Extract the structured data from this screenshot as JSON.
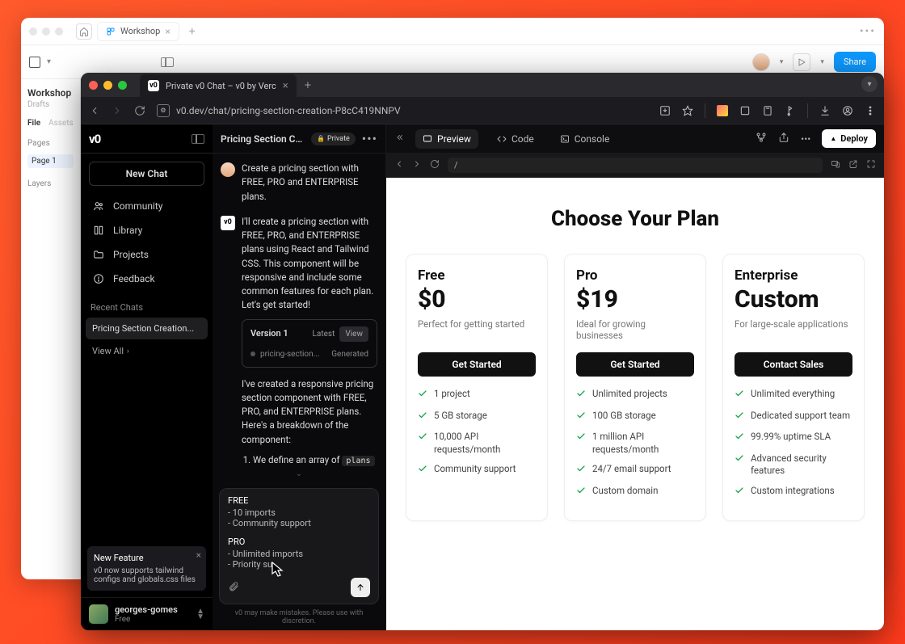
{
  "figma": {
    "tab_label": "Workshop",
    "workspace_title": "Workshop",
    "workspace_sub": "Drafts",
    "tab_file": "File",
    "tab_assets": "Assets",
    "pages_label": "Pages",
    "page1_label": "Page 1",
    "layers_label": "Layers",
    "share_label": "Share"
  },
  "browser": {
    "tab_title": "Private v0 Chat – v0 by Verc",
    "url": "v0.dev/chat/pricing-section-creation-P8cC419NNPV"
  },
  "sidebar": {
    "logo": "v0",
    "new_chat": "New Chat",
    "items": [
      {
        "label": "Community"
      },
      {
        "label": "Library"
      },
      {
        "label": "Projects"
      },
      {
        "label": "Feedback"
      }
    ],
    "recent_label": "Recent Chats",
    "recent_item": "Pricing Section Creation...",
    "view_all": "View All",
    "toast_title": "New Feature",
    "toast_body": "v0 now supports tailwind configs and globals.css files",
    "user_name": "georges-gomes",
    "user_plan": "Free"
  },
  "chat": {
    "title": "Pricing Section Creati...",
    "badge": "Private",
    "user_msg": "Create a pricing section with FREE, PRO and ENTERPRISE plans.",
    "ai_msg1": "I'll create a pricing section with FREE, PRO, and ENTERPRISE plans using React and Tailwind CSS. This component will be responsive and include some common features for each plan. Let's get started!",
    "version": {
      "label": "Version 1",
      "latest": "Latest",
      "view": "View",
      "file": "pricing-section...",
      "status": "Generated"
    },
    "ai_msg2": "I've created a responsive pricing section component with FREE, PRO, and ENTERPRISE plans. Here's a breakdown of the component:",
    "ai_li1_pre": "We define an array of ",
    "ai_li1_code": "plans",
    "input": {
      "free_label": "FREE",
      "free_l1": "- 10 imports",
      "free_l2": "- Community support",
      "pro_label": "PRO",
      "pro_l1": "- Unlimited imports",
      "pro_l2": "- Priority su"
    },
    "disclaimer": "v0 may make mistakes. Please use with discretion."
  },
  "preview_tabs": {
    "preview": "Preview",
    "code": "Code",
    "console": "Console",
    "deploy": "Deploy"
  },
  "preview_addr": {
    "path": "/"
  },
  "pricing": {
    "title": "Choose Your Plan",
    "plans": [
      {
        "name": "Free",
        "price": "$0",
        "desc": "Perfect for getting started",
        "cta": "Get Started",
        "features": [
          "1 project",
          "5 GB storage",
          "10,000 API requests/month",
          "Community support"
        ]
      },
      {
        "name": "Pro",
        "price": "$19",
        "desc": "Ideal for growing businesses",
        "cta": "Get Started",
        "features": [
          "Unlimited projects",
          "100 GB storage",
          "1 million API requests/month",
          "24/7 email support",
          "Custom domain"
        ]
      },
      {
        "name": "Enterprise",
        "price": "Custom",
        "desc": "For large-scale applications",
        "cta": "Contact Sales",
        "features": [
          "Unlimited everything",
          "Dedicated support team",
          "99.99% uptime SLA",
          "Advanced security features",
          "Custom integrations"
        ]
      }
    ]
  }
}
